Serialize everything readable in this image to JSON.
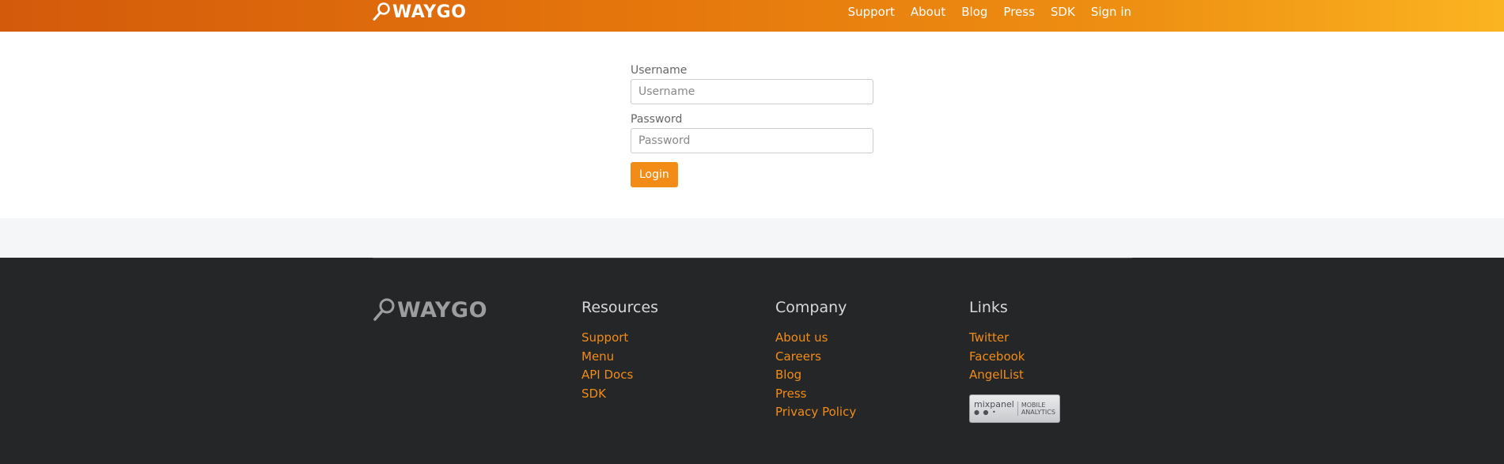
{
  "header": {
    "logo_text": "WAYGO",
    "nav": [
      "Support",
      "About",
      "Blog",
      "Press",
      "SDK",
      "Sign in"
    ]
  },
  "login": {
    "username_label": "Username",
    "username_placeholder": "Username",
    "password_label": "Password",
    "password_placeholder": "Password",
    "submit_label": "Login"
  },
  "footer": {
    "logo_text": "WAYGO",
    "resources": {
      "title": "Resources",
      "links": [
        "Support",
        "Menu",
        "API Docs",
        "SDK"
      ]
    },
    "company": {
      "title": "Company",
      "links": [
        "About us",
        "Careers",
        "Blog",
        "Press",
        "Privacy Policy"
      ]
    },
    "links": {
      "title": "Links",
      "links": [
        "Twitter",
        "Facebook",
        "AngelList"
      ]
    },
    "badge": {
      "name": "mixpanel",
      "tag_line1": "MOBILE",
      "tag_line2": "ANALYTICS"
    }
  },
  "colors": {
    "brand_orange": "#f28c17",
    "header_gradient_start": "#d35a0b",
    "header_gradient_end": "#fbb421",
    "footer_bg": "#252628"
  }
}
